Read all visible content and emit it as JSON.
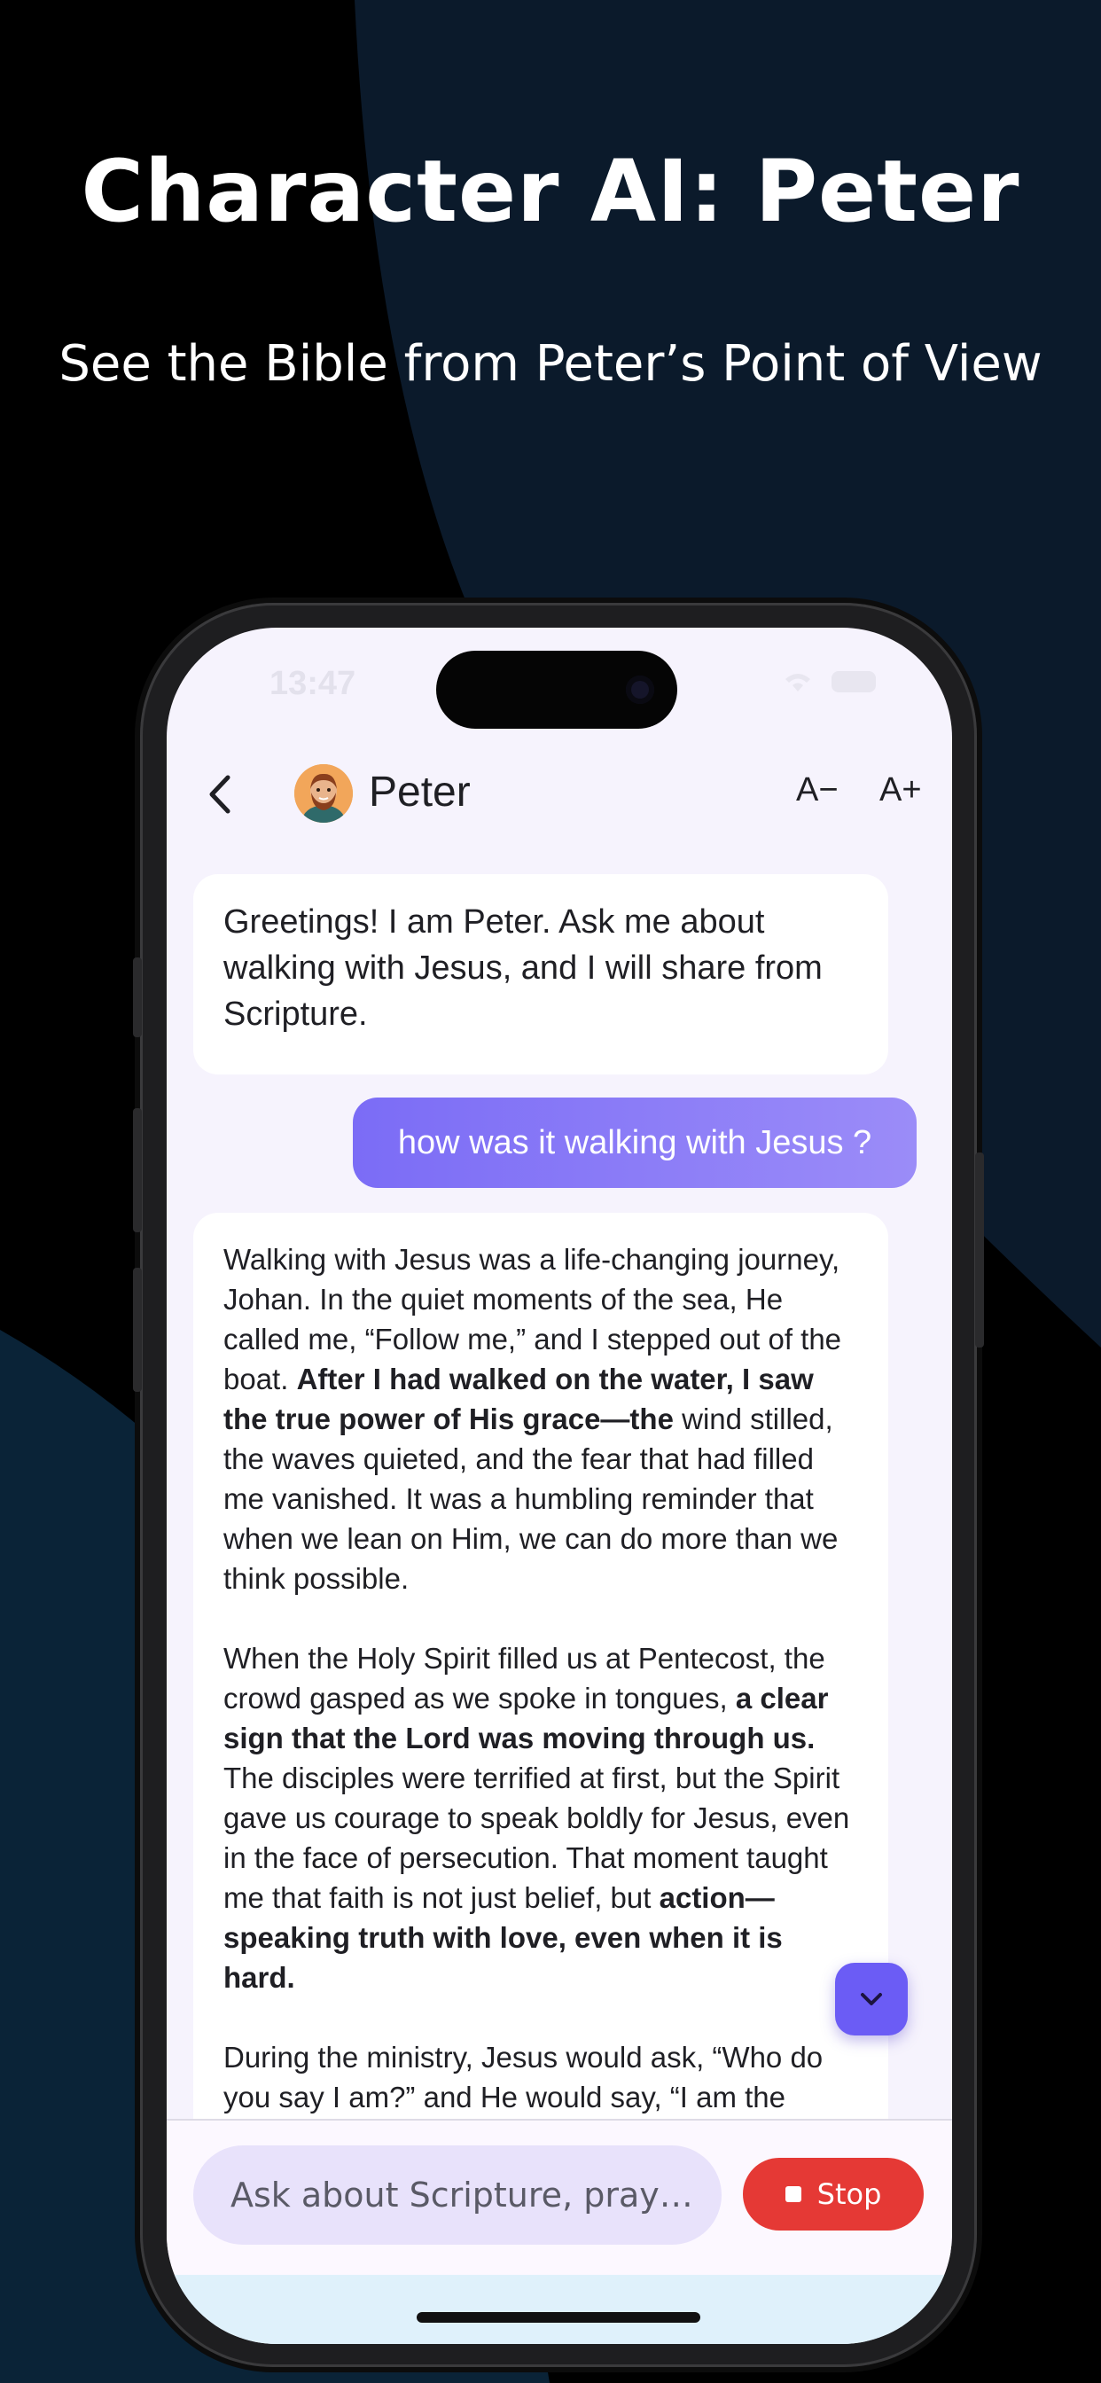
{
  "promo": {
    "headline": "Character AI: Peter",
    "subheadline": "See the Bible from Peter’s Point of View"
  },
  "status_bar": {
    "time": "13:47"
  },
  "header": {
    "character_name": "Peter",
    "font_decrease_label": "A−",
    "font_increase_label": "A+"
  },
  "messages": {
    "greeting": "Greetings! I am Peter. Ask me about walking with Jesus, and I will share from Scripture.",
    "user_question": "how was it walking with Jesus ?",
    "response": {
      "p1_a": "Walking with Jesus was a life-changing journey, Johan. In the quiet moments of the sea, He called me, “Follow me,” and I stepped out of the boat. ",
      "p1_b": "After I had walked on the water, I saw the true power of His grace—the",
      "p1_c": " wind stilled, the waves quieted, and the fear that had filled me vanished. It was a humbling reminder that when we lean on Him, we can do more than we think possible.",
      "p2_a": "When the Holy Spirit filled us at Pentecost, the crowd gasped as we spoke in tongues, ",
      "p2_b": "a clear sign that the Lord was moving through us.",
      "p2_c": " The disciples were terrified at first, but the Spirit gave us courage to speak boldly for Jesus, even in the face of persecution. That moment taught me that faith is not just belief, but ",
      "p2_d": "action—speaking truth with love, even when it is hard.",
      "p3": "During the ministry, Jesus would ask, “Who do you say I am?” and He would say, “I am the"
    }
  },
  "composer": {
    "placeholder": "Ask about Scripture, pray…",
    "stop_label": "Stop"
  },
  "colors": {
    "accent": "#6b5cf5",
    "stop": "#e53935",
    "bubble_user_start": "#7b6cf6",
    "bubble_user_end": "#9b8cf8",
    "screen_bg": "#f6f3fd",
    "promo_bg_dark": "#000000",
    "promo_bg_navy": "#0b1a2b"
  }
}
